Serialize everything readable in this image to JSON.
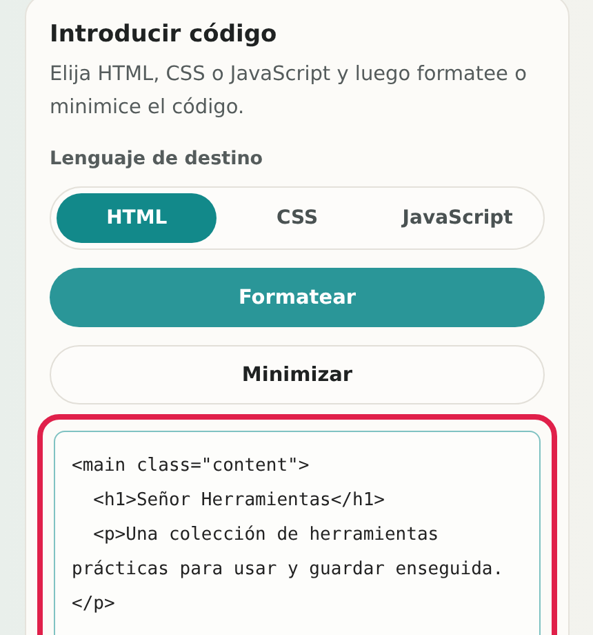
{
  "card": {
    "title": "Introducir código",
    "description": "Elija HTML, CSS o JavaScript y luego formatee o minimice el código.",
    "language_label": "Lenguaje de destino"
  },
  "languages": [
    {
      "label": "HTML",
      "selected": true
    },
    {
      "label": "CSS",
      "selected": false
    },
    {
      "label": "JavaScript",
      "selected": false
    }
  ],
  "buttons": [
    {
      "label": "Formatear",
      "kind": "primary"
    },
    {
      "label": "Minimizar",
      "kind": "secondary"
    }
  ],
  "editor": {
    "highlighted": true,
    "value": "<main class=\"content\">\n  <h1>Señor Herramientas</h1>\n  <p>Una colección de herramientas prácticas para usar y guardar enseguida.</p>"
  }
}
